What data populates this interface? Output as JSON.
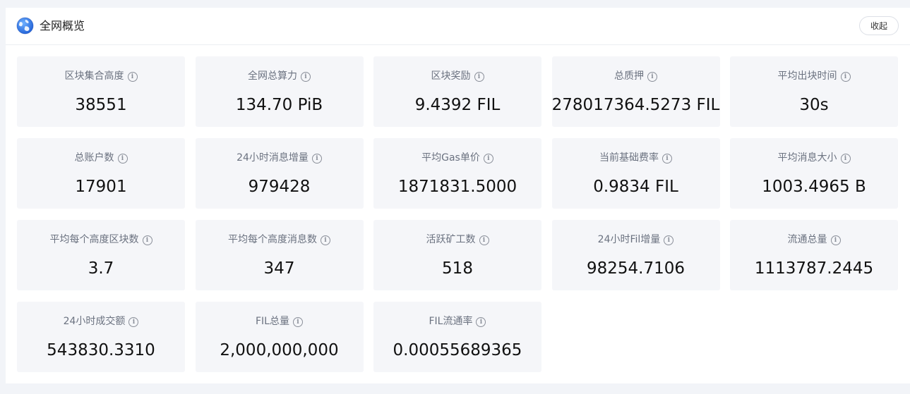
{
  "header": {
    "title": "全网概览",
    "collapse_label": "收起",
    "icon": "globe-icon"
  },
  "info_icon_glyph": "i",
  "stats": [
    {
      "label": "区块集合高度",
      "value": "38551"
    },
    {
      "label": "全网总算力",
      "value": "134.70 PiB"
    },
    {
      "label": "区块奖励",
      "value": "9.4392 FIL"
    },
    {
      "label": "总质押",
      "value": "278017364.5273 FIL"
    },
    {
      "label": "平均出块时间",
      "value": "30s"
    },
    {
      "label": "总账户数",
      "value": "17901"
    },
    {
      "label": "24小时消息增量",
      "value": "979428"
    },
    {
      "label": "平均Gas单价",
      "value": "1871831.5000"
    },
    {
      "label": "当前基础费率",
      "value": "0.9834 FIL"
    },
    {
      "label": "平均消息大小",
      "value": "1003.4965 B"
    },
    {
      "label": "平均每个高度区块数",
      "value": "3.7"
    },
    {
      "label": "平均每个高度消息数",
      "value": "347"
    },
    {
      "label": "活跃矿工数",
      "value": "518"
    },
    {
      "label": "24小时Fil增量",
      "value": "98254.7106"
    },
    {
      "label": "流通总量",
      "value": "1113787.2445"
    },
    {
      "label": "24小时成交额",
      "value": "543830.3310"
    },
    {
      "label": "FIL总量",
      "value": "2,000,000,000"
    },
    {
      "label": "FIL流通率",
      "value": "0.00055689365"
    }
  ],
  "colors": {
    "page_bg": "#f2f4f8",
    "card_bg": "#f5f6f9",
    "label": "#6b7280",
    "value": "#111111",
    "globe_blue": "#2f7cf6"
  }
}
